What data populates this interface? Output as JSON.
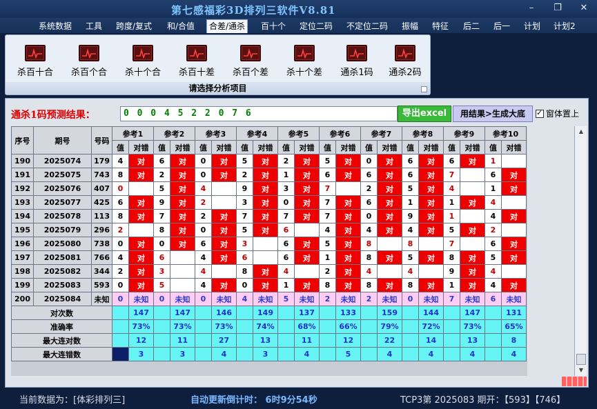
{
  "window": {
    "title": "第七感福彩3D排列三软件V8.81",
    "buttons": [
      "–",
      "❐",
      "✕"
    ]
  },
  "menu": {
    "items": [
      "系统数据",
      "工具",
      "跨度/复式",
      "和/合值",
      "合差/通杀",
      "百十个",
      "定位二码",
      "不定位二码",
      "振幅",
      "特征",
      "后二",
      "后一",
      "计划",
      "计划2"
    ],
    "active": "合差/通杀"
  },
  "ribbon": {
    "tools": [
      "杀百十合",
      "杀百个合",
      "杀十个合",
      "杀百十差",
      "杀百个差",
      "杀十个差",
      "通杀1码",
      "通杀2码"
    ],
    "caption": "请选择分析项目",
    "icon": "chart-icon"
  },
  "prediction": {
    "label": "通杀1码预测结果：",
    "value": "0 0 0 4 5 2 2 0 7 6",
    "excel_button": "导出excel",
    "generate_button": "用结果>生成大底",
    "topmost_label": "窗体置上",
    "topmost_checked": true
  },
  "grid": {
    "headers": {
      "seq": "序号",
      "period": "期号",
      "number": "号码",
      "refs": [
        "参考1",
        "参考2",
        "参考3",
        "参考4",
        "参考5",
        "参考6",
        "参考7",
        "参考8",
        "参考9",
        "参考10"
      ],
      "value": "值",
      "check": "对错"
    },
    "rows": [
      {
        "seq": "190",
        "period": "2025074",
        "num": "179",
        "cells": [
          [
            "4",
            1
          ],
          [
            "6",
            1
          ],
          [
            "0",
            1
          ],
          [
            "5",
            1
          ],
          [
            "2",
            1
          ],
          [
            "5",
            1
          ],
          [
            "0",
            1
          ],
          [
            "6",
            1
          ],
          [
            "6",
            1
          ],
          [
            "1",
            0
          ]
        ]
      },
      {
        "seq": "191",
        "period": "2025075",
        "num": "743",
        "cells": [
          [
            "8",
            1
          ],
          [
            "2",
            1
          ],
          [
            "0",
            1
          ],
          [
            "2",
            1
          ],
          [
            "1",
            1
          ],
          [
            "6",
            1
          ],
          [
            "6",
            1
          ],
          [
            "6",
            1
          ],
          [
            "7",
            0
          ],
          [
            "6",
            1
          ]
        ]
      },
      {
        "seq": "192",
        "period": "2025076",
        "num": "407",
        "cells": [
          [
            "0",
            0
          ],
          [
            "5",
            1
          ],
          [
            "4",
            0
          ],
          [
            "9",
            1
          ],
          [
            "3",
            1
          ],
          [
            "7",
            0
          ],
          [
            "2",
            1
          ],
          [
            "5",
            1
          ],
          [
            "4",
            0
          ],
          [
            "1",
            1
          ]
        ]
      },
      {
        "seq": "193",
        "period": "2025077",
        "num": "425",
        "cells": [
          [
            "6",
            1
          ],
          [
            "9",
            1
          ],
          [
            "2",
            0
          ],
          [
            "3",
            1
          ],
          [
            "0",
            1
          ],
          [
            "7",
            1
          ],
          [
            "6",
            1
          ],
          [
            "1",
            1
          ],
          [
            "1",
            1
          ],
          [
            "4",
            0
          ]
        ]
      },
      {
        "seq": "194",
        "period": "2025078",
        "num": "113",
        "cells": [
          [
            "8",
            1
          ],
          [
            "7",
            1
          ],
          [
            "2",
            1
          ],
          [
            "7",
            1
          ],
          [
            "7",
            1
          ],
          [
            "7",
            1
          ],
          [
            "0",
            1
          ],
          [
            "9",
            1
          ],
          [
            "1",
            0
          ],
          [
            "4",
            1
          ]
        ]
      },
      {
        "seq": "195",
        "period": "2025079",
        "num": "296",
        "cells": [
          [
            "2",
            0
          ],
          [
            "8",
            1
          ],
          [
            "0",
            1
          ],
          [
            "5",
            1
          ],
          [
            "6",
            0
          ],
          [
            "4",
            1
          ],
          [
            "4",
            1
          ],
          [
            "4",
            1
          ],
          [
            "5",
            1
          ],
          [
            "2",
            0
          ]
        ]
      },
      {
        "seq": "196",
        "period": "2025080",
        "num": "738",
        "cells": [
          [
            "0",
            1
          ],
          [
            "0",
            1
          ],
          [
            "6",
            1
          ],
          [
            "3",
            0
          ],
          [
            "6",
            1
          ],
          [
            "5",
            1
          ],
          [
            "8",
            0
          ],
          [
            "8",
            0
          ],
          [
            "7",
            0
          ],
          [
            "6",
            1
          ]
        ]
      },
      {
        "seq": "197",
        "period": "2025081",
        "num": "766",
        "cells": [
          [
            "4",
            1
          ],
          [
            "6",
            0
          ],
          [
            "4",
            1
          ],
          [
            "6",
            0
          ],
          [
            "6",
            1
          ],
          [
            "1",
            1
          ],
          [
            "8",
            1
          ],
          [
            "5",
            1
          ],
          [
            "8",
            1
          ],
          [
            "5",
            1
          ]
        ]
      },
      {
        "seq": "198",
        "period": "2025082",
        "num": "344",
        "cells": [
          [
            "2",
            1
          ],
          [
            "3",
            0
          ],
          [
            "4",
            0
          ],
          [
            "8",
            1
          ],
          [
            "4",
            0
          ],
          [
            "2",
            1
          ],
          [
            "4",
            0
          ],
          [
            "4",
            0
          ],
          [
            "9",
            1
          ],
          [
            "4",
            0
          ]
        ]
      },
      {
        "seq": "199",
        "period": "2025083",
        "num": "593",
        "cells": [
          [
            "0",
            1
          ],
          [
            "5",
            0
          ],
          [
            "4",
            1
          ],
          [
            "0",
            1
          ],
          [
            "1",
            1
          ],
          [
            "8",
            1
          ],
          [
            "8",
            1
          ],
          [
            "8",
            1
          ],
          [
            "1",
            1
          ],
          [
            "4",
            1
          ]
        ]
      }
    ],
    "pending": {
      "seq": "200",
      "period": "2025084",
      "num": "未知",
      "values": [
        "0",
        "0",
        "0",
        "4",
        "5",
        "2",
        "2",
        "0",
        "7",
        "6"
      ],
      "mark": "未知"
    },
    "stats": [
      {
        "label": "对次数",
        "values": [
          "147",
          "147",
          "146",
          "149",
          "137",
          "133",
          "159",
          "144",
          "147",
          "131"
        ]
      },
      {
        "label": "准确率",
        "values": [
          "73%",
          "73%",
          "73%",
          "74%",
          "68%",
          "66%",
          "79%",
          "72%",
          "73%",
          "65%"
        ]
      },
      {
        "label": "最大连对数",
        "values": [
          "12",
          "11",
          "27",
          "13",
          "11",
          "12",
          "22",
          "14",
          "13",
          "8"
        ]
      },
      {
        "label": "最大连错数",
        "values": [
          "3",
          "3",
          "4",
          "3",
          "4",
          "5",
          "4",
          "4",
          "4",
          "4"
        ]
      }
    ],
    "hit_mark": "对"
  },
  "status": {
    "current_data": "当前数据为：[体彩排列三]",
    "countdown": "自动更新倒计时：  6时9分54秒",
    "latest": "TCP3第 2025083 期开：【593】【746】"
  },
  "colors": {
    "background": "#0d1f3c",
    "hit_red": "#ee0000",
    "stat_cyan": "#66f4f4",
    "pending_pink": "#ffccf4",
    "title_blue": "#7fc4ff"
  }
}
